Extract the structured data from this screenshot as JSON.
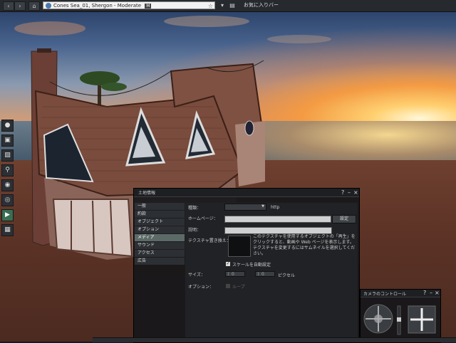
{
  "topbar": {
    "location_text": "Cones Sea_01, Shergon - Moderate",
    "maturity_badge": "M",
    "favorites_label": "お気に入りバー",
    "back_icon": "back-arrow-icon",
    "forward_icon": "forward-arrow-icon",
    "home_icon": "home-icon"
  },
  "left_toolbar": {
    "icons": [
      "people-icon",
      "shirt-icon",
      "inventory-icon",
      "search-icon",
      "lightbulb-icon",
      "snapshot-icon",
      "media-icon",
      "map-icon"
    ],
    "active_index": 6
  },
  "land_panel": {
    "title": "土地情報",
    "help_icon": "?",
    "minimize_icon": "–",
    "close_icon": "×",
    "tabs": [
      "一般",
      "約款",
      "オブジェクト",
      "オプション",
      "メディア",
      "サウンド",
      "アクセス",
      "広告"
    ],
    "active_tab": 4,
    "media": {
      "type_label": "種類：",
      "type_value": "",
      "http_label": "http",
      "homepage_label": "ホームページ：",
      "set_button": "設定",
      "description_label": "説明：",
      "replace_texture_label": "テクスチャ置き換え：",
      "description_text": "このテクスチャを使用するオブジェクトの「再生」をクリックすると、動画や Web ページを表示します。テクスチャを変更するにはサムネイルを選択してください。",
      "auto_scale_label": "スケールを自動設定",
      "auto_scale_checked": true,
      "size_label": "サイズ：",
      "width_value": "0",
      "height_value": "0",
      "pixels_label": "ピクセル",
      "options_label": "オプション：",
      "loop_label": "ループ",
      "loop_checked": false
    }
  },
  "camera_panel": {
    "title": "カメラのコントロール",
    "help_icon": "?",
    "minimize_icon": "–",
    "close_icon": "×"
  }
}
